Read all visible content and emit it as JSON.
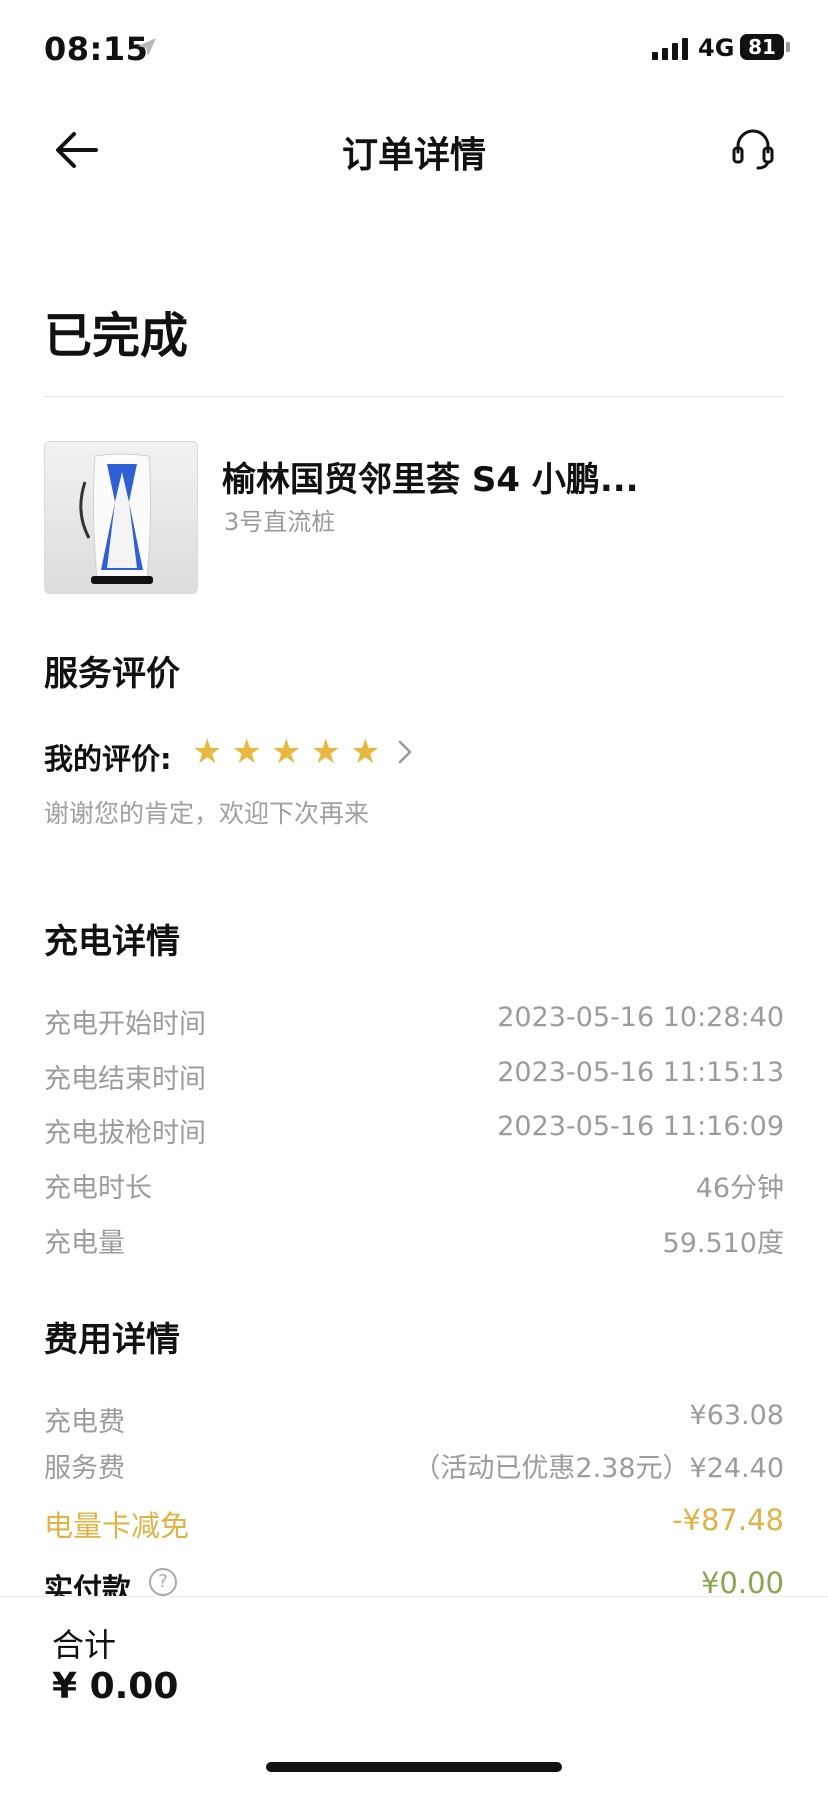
{
  "status_bar": {
    "time": "08:15",
    "network": "4G",
    "battery": "81"
  },
  "nav": {
    "title": "订单详情",
    "back_icon": "arrow-left-icon",
    "support_icon": "headset-icon"
  },
  "order": {
    "status": "已完成",
    "station_name": "榆林国贸邻里荟 S4 小鹏...",
    "pile": "3号直流桩"
  },
  "rating": {
    "section_title": "服务评价",
    "label": "我的评价:",
    "stars": 5,
    "message": "谢谢您的肯定，欢迎下次再来"
  },
  "charging": {
    "section_title": "充电详情",
    "rows": [
      {
        "label": "充电开始时间",
        "value": "2023-05-16 10:28:40"
      },
      {
        "label": "充电结束时间",
        "value": "2023-05-16 11:15:13"
      },
      {
        "label": "充电拔枪时间",
        "value": "2023-05-16 11:16:09"
      },
      {
        "label": "充电时长",
        "value": "46分钟"
      },
      {
        "label": "充电量",
        "value": "59.510度"
      }
    ]
  },
  "fees": {
    "section_title": "费用详情",
    "rows": [
      {
        "label": "充电费",
        "value": "¥63.08"
      },
      {
        "label": "服务费",
        "value": "（活动已优惠2.38元）¥24.40"
      }
    ],
    "discount": {
      "label": "电量卡减免",
      "value": "-¥87.48"
    },
    "paid": {
      "label": "实付款",
      "value": "¥0.00"
    }
  },
  "footer": {
    "total_label": "合计",
    "total_amount": "¥ 0.00"
  },
  "colors": {
    "star": "#e9b93f",
    "discount": "#e2b344",
    "paid": "#86a84a",
    "muted": "#9c9c9c"
  }
}
